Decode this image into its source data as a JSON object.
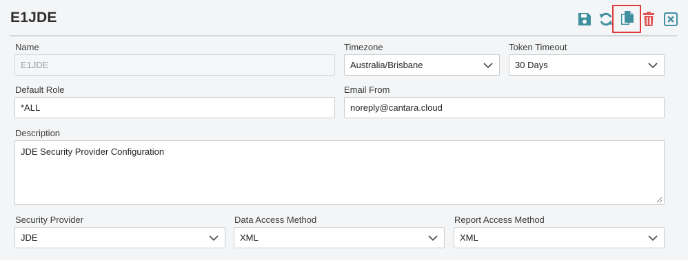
{
  "header": {
    "title": "E1JDE"
  },
  "toolbar": {
    "buttons": [
      {
        "icon": "save-icon"
      },
      {
        "icon": "refresh-icon"
      },
      {
        "icon": "copy-icon",
        "highlighted": true
      },
      {
        "icon": "delete-icon"
      },
      {
        "icon": "close-icon"
      }
    ],
    "colors": {
      "teal": "#3f8f9f",
      "red": "#e05555",
      "highlight": "#e0393b"
    }
  },
  "form": {
    "name": {
      "label": "Name",
      "value": "E1JDE"
    },
    "timezone": {
      "label": "Timezone",
      "value": "Australia/Brisbane"
    },
    "token_timeout": {
      "label": "Token Timeout",
      "value": "30 Days"
    },
    "default_role": {
      "label": "Default Role",
      "value": "*ALL"
    },
    "email_from": {
      "label": "Email From",
      "value": "noreply@cantara.cloud"
    },
    "description": {
      "label": "Description",
      "value": "JDE Security Provider Configuration"
    },
    "security_provider": {
      "label": "Security Provider",
      "value": "JDE"
    },
    "data_access_method": {
      "label": "Data Access Method",
      "value": "XML"
    },
    "report_access_method": {
      "label": "Report Access Method",
      "value": "XML"
    }
  }
}
